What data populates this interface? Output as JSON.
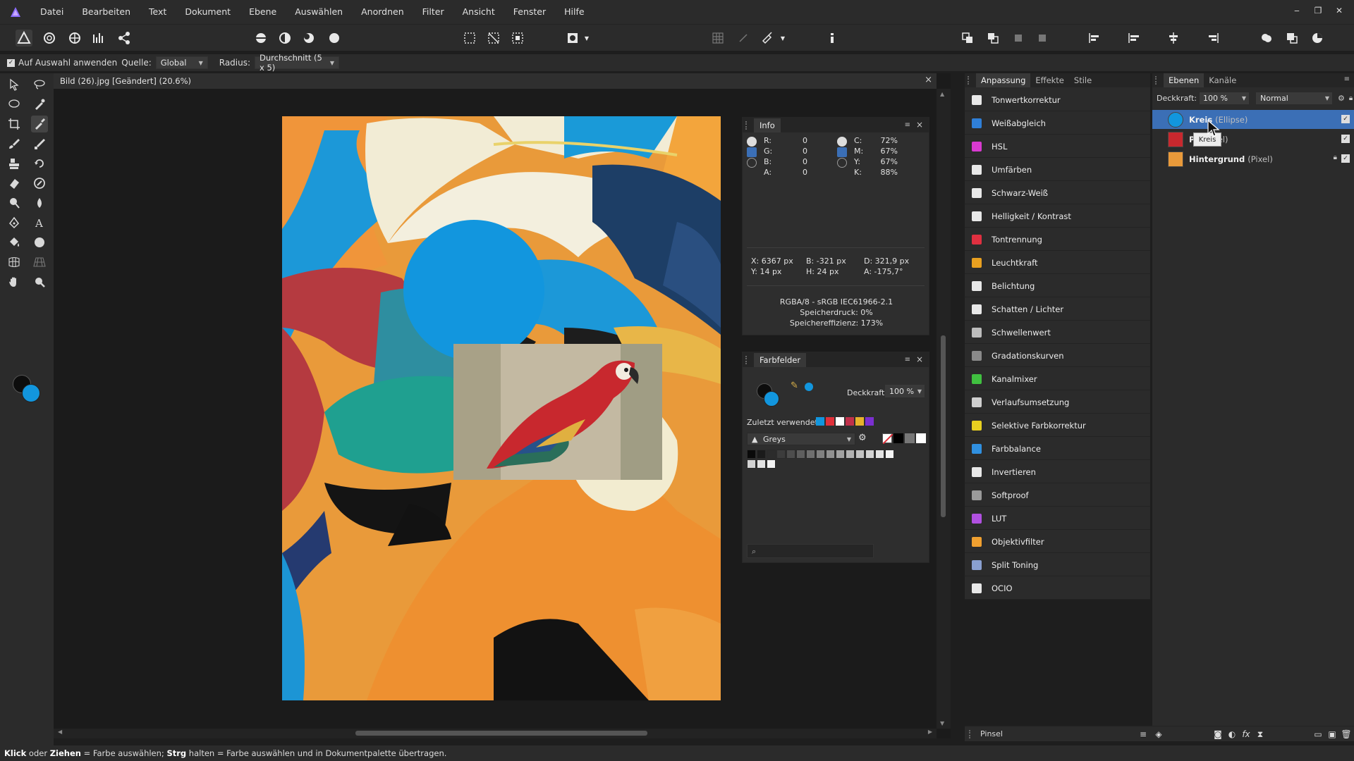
{
  "app": {
    "logo_icon": "affinity-photo-logo",
    "accent": "#7b5cff"
  },
  "menu": [
    "Datei",
    "Bearbeiten",
    "Text",
    "Dokument",
    "Ebene",
    "Auswählen",
    "Anordnen",
    "Filter",
    "Ansicht",
    "Fenster",
    "Hilfe"
  ],
  "window_controls": {
    "minimize": "‒",
    "restore": "❐",
    "close": "✕"
  },
  "context_bar": {
    "apply_to_selection": "Auf Auswahl anwenden",
    "source_label": "Quelle:",
    "source_value": "Global",
    "radius_label": "Radius:",
    "radius_value": "Durchschnitt (5 x 5)"
  },
  "document": {
    "tab_title": "Bild (26).jpg [Geändert] (20.6%)",
    "close": "×"
  },
  "info_panel": {
    "title": "Info",
    "rgb": [
      [
        "R:",
        "0"
      ],
      [
        "G:",
        "0"
      ],
      [
        "B:",
        "0"
      ],
      [
        "A:",
        "0"
      ]
    ],
    "cmyk": [
      [
        "C:",
        "72%"
      ],
      [
        "M:",
        "67%"
      ],
      [
        "Y:",
        "67%"
      ],
      [
        "K:",
        "88%"
      ]
    ],
    "coords": {
      "x": "X: 6367 px",
      "y": "Y: 14 px",
      "b": "B: -321 px",
      "h": "H: 24 px",
      "d": "D: 321,9 px",
      "a": "A: -175,7°"
    },
    "meta": [
      "RGBA/8 - sRGB IEC61966-2.1",
      "Speicherdruck: 0%",
      "Speichereffizienz: 173%"
    ]
  },
  "swatch_panel": {
    "title": "Farbfelder",
    "opacity_label": "Deckkraft:",
    "opacity_value": "100 %",
    "recent_label": "Zuletzt verwendet:",
    "recent_colors": [
      "#1296de",
      "#e0303a",
      "#ffffff",
      "#c0304a",
      "#e7b22c",
      "#7b2fd0"
    ],
    "palette_name": "Greys"
  },
  "adjustment_panel": {
    "tabs": [
      "Anpassung",
      "Effekte",
      "Stile"
    ],
    "items": [
      {
        "label": "Tonwertkorrektur",
        "icon": "levels-icon",
        "color": "#e8e8e8"
      },
      {
        "label": "Weißabgleich",
        "icon": "white-balance-icon",
        "color": "#2f7fd8"
      },
      {
        "label": "HSL",
        "icon": "hsl-icon",
        "color": "#d83ad0"
      },
      {
        "label": "Umfärben",
        "icon": "recolor-icon",
        "color": "#e8e8e8"
      },
      {
        "label": "Schwarz-Weiß",
        "icon": "black-white-icon",
        "color": "#e8e8e8"
      },
      {
        "label": "Helligkeit / Kontrast",
        "icon": "brightness-contrast-icon",
        "color": "#e8e8e8"
      },
      {
        "label": "Tontrennung",
        "icon": "posterize-icon",
        "color": "#e03040"
      },
      {
        "label": "Leuchtkraft",
        "icon": "vibrance-icon",
        "color": "#e8a020"
      },
      {
        "label": "Belichtung",
        "icon": "exposure-icon",
        "color": "#e8e8e8"
      },
      {
        "label": "Schatten / Lichter",
        "icon": "shadows-highlights-icon",
        "color": "#e8e8e8"
      },
      {
        "label": "Schwellenwert",
        "icon": "threshold-icon",
        "color": "#bdbdbd"
      },
      {
        "label": "Gradationskurven",
        "icon": "curves-icon",
        "color": "#8a8a8a"
      },
      {
        "label": "Kanalmixer",
        "icon": "channel-mixer-icon",
        "color": "#40c040"
      },
      {
        "label": "Verlaufsumsetzung",
        "icon": "gradient-map-icon",
        "color": "#cfcfcf"
      },
      {
        "label": "Selektive Farbkorrektur",
        "icon": "selective-color-icon",
        "color": "#e8d020"
      },
      {
        "label": "Farbbalance",
        "icon": "color-balance-icon",
        "color": "#3090e0"
      },
      {
        "label": "Invertieren",
        "icon": "invert-icon",
        "color": "#e8e8e8"
      },
      {
        "label": "Softproof",
        "icon": "soft-proof-icon",
        "color": "#9a9a9a"
      },
      {
        "label": "LUT",
        "icon": "lut-icon",
        "color": "#b050e0"
      },
      {
        "label": "Objektivfilter",
        "icon": "lens-filter-icon",
        "color": "#f0a030"
      },
      {
        "label": "Split Toning",
        "icon": "split-toning-icon",
        "color": "#8aa0d0"
      },
      {
        "label": "OCIO",
        "icon": "ocio-icon",
        "color": "#e8e8e8"
      }
    ]
  },
  "layers_panel": {
    "tabs": [
      "Ebenen",
      "Kanäle"
    ],
    "opacity_label": "Deckkraft:",
    "opacity_value": "100 %",
    "blend_mode": "Normal",
    "tooltip": "Kreis",
    "layers": [
      {
        "name": "Kreis",
        "type": "(Ellipse)",
        "selected": true,
        "locked": false
      },
      {
        "name": "Pa",
        "type": "(Pixel)",
        "selected": false,
        "locked": false
      },
      {
        "name": "Hintergrund",
        "type": "(Pixel)",
        "selected": false,
        "locked": true
      }
    ]
  },
  "bottom_panel": {
    "brush_tab": "Pinsel"
  },
  "status": {
    "k1": "Klick",
    "t1": " oder ",
    "k2": "Ziehen",
    "t2": " = Farbe auswählen; ",
    "k3": "Strg",
    "t3": " halten = Farbe auswählen und in Dokumentpalette übertragen."
  }
}
